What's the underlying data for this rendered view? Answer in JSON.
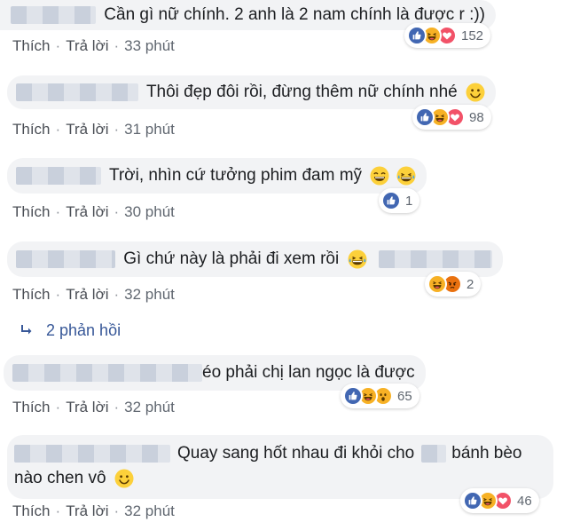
{
  "colors": {
    "bubble_bg": "#f2f3f5",
    "meta_text": "#606770",
    "like_blue": "#4267b2",
    "haha_yellow": "#f7b125",
    "love_red": "#f25268",
    "angry_orange": "#e9710f",
    "link_blue": "#385898"
  },
  "actions": {
    "like": "Thích",
    "reply": "Trả lời"
  },
  "comments": [
    {
      "text": "Cần gì nữ chính. 2 anh là 2 nam chính là được r :))",
      "time": "33 phút",
      "reactions": [
        "like-icon",
        "haha-icon",
        "love-icon"
      ],
      "count": "152"
    },
    {
      "text": "Thôi đẹp đôi rồi, đừng thêm nữ chính nhé",
      "time": "31 phút",
      "reactions": [
        "like-icon",
        "haha-icon",
        "love-icon"
      ],
      "count": "98"
    },
    {
      "text": "Trời, nhìn cứ tưởng phim đam mỹ",
      "time": "30 phút",
      "reactions": [
        "like-icon"
      ],
      "count": "1"
    },
    {
      "text": "Gì chứ này là phải đi xem rồi",
      "time": "32 phút",
      "reactions": [
        "haha-icon",
        "angry-icon"
      ],
      "count": "2"
    },
    {
      "text": "éo phải chị lan ngọc là được",
      "time": "32 phút",
      "reactions": [
        "like-icon",
        "haha-icon",
        "wow-icon"
      ],
      "count": "65"
    },
    {
      "text_line1": "Quay sang hốt nhau đi khỏi cho",
      "text_line1b": "bánh bèo",
      "text_line2": "nào chen vô",
      "time": "32 phút",
      "reactions": [
        "like-icon",
        "haha-icon",
        "love-icon"
      ],
      "count": "46"
    }
  ],
  "replies_link": {
    "label": "2 phản hồi",
    "icon": "reply-arrow-icon"
  }
}
